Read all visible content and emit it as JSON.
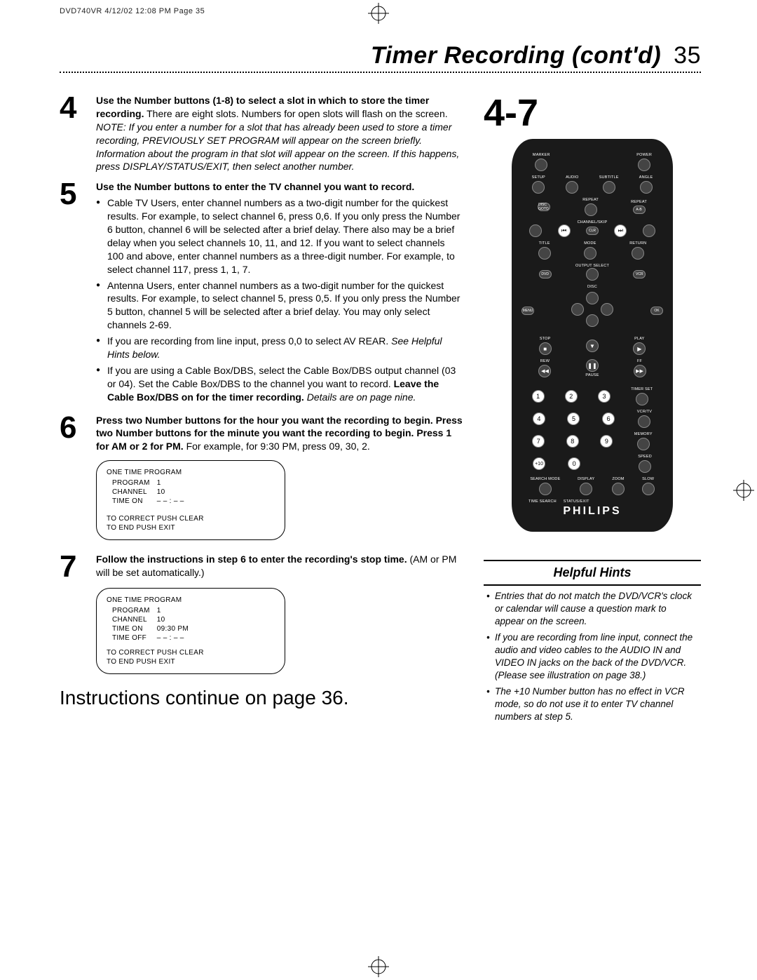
{
  "print_header": "DVD740VR   4/12/02   12:08 PM   Page 35",
  "title": "Timer Recording (cont'd)",
  "page_number": "35",
  "big_steps": "4-7",
  "steps": {
    "s4": {
      "num": "4",
      "bold1": "Use the Number buttons (1-8) to select a slot in which to store the timer recording.",
      "rest": " There are eight slots. Numbers for open slots will flash on the screen.",
      "note": "NOTE: If you enter a number for a slot that has already been used to store a timer recording, PREVIOUSLY SET PROGRAM will appear on the screen briefly. Information about the program in that slot will appear on the screen. If this happens, press DISPLAY/STATUS/EXIT, then select another number."
    },
    "s5": {
      "num": "5",
      "bold1": "Use the Number buttons to enter the TV channel you want to record.",
      "b1": "Cable TV Users, enter channel numbers as a two-digit number for the quickest results. For example, to select channel 6, press 0,6. If you only press the Number 6 button, channel 6 will be selected after a brief delay. There also may be a brief delay when you select channels 10, 11, and 12. If you want to select channels 100 and above, enter channel numbers as a three-digit number. For example, to select channel 117, press 1, 1, 7.",
      "b2": "Antenna Users, enter channel numbers as a two-digit number for the quickest results. For example, to select channel 5, press 0,5. If you only press the Number 5 button, channel 5 will be selected after a brief delay. You may only select channels 2-69.",
      "b3a": "If you are recording from line input, press 0,0 to select AV REAR. ",
      "b3b": "See Helpful Hints below.",
      "b4a": "If you are using a Cable Box/DBS, select the Cable Box/DBS output channel (03 or 04). Set the Cable Box/DBS to the channel you want to record. ",
      "b4bold": "Leave the Cable Box/DBS on for the timer recording.",
      "b4c": " Details are on page nine."
    },
    "s6": {
      "num": "6",
      "bold1": "Press two Number buttons for the hour you want the recording to begin. Press two Number buttons for the minute you want the recording to begin. Press 1 for AM or 2 for PM.",
      "rest": " For example, for 9:30 PM, press 09, 30, 2."
    },
    "s7": {
      "num": "7",
      "bold1": "Follow the instructions in step 6 to enter the recording's stop time.",
      "rest": " (AM or PM will be set automatically.)"
    }
  },
  "screen1": {
    "title": "ONE TIME PROGRAM",
    "rows": [
      [
        "PROGRAM",
        "1"
      ],
      [
        "CHANNEL",
        "10"
      ],
      [
        "TIME ON",
        "– – : – –"
      ]
    ],
    "foot1": "TO CORRECT PUSH CLEAR",
    "foot2": "TO END PUSH EXIT"
  },
  "screen2": {
    "title": "ONE TIME PROGRAM",
    "rows": [
      [
        "PROGRAM",
        "1"
      ],
      [
        "CHANNEL",
        "10"
      ],
      [
        "TIME ON",
        "09:30 PM"
      ],
      [
        "TIME OFF",
        "– – : – –"
      ]
    ],
    "foot1": "TO CORRECT PUSH CLEAR",
    "foot2": "TO END PUSH EXIT"
  },
  "continue_text": "Instructions continue on page 36.",
  "remote": {
    "brand": "PHILIPS",
    "labels": {
      "power": "POWER",
      "marker": "MARKER",
      "setup": "SETUP",
      "audio": "AUDIO",
      "subtitle": "SUBTITLE",
      "angle": "ANGLE",
      "discgoto": "DISC GOTO",
      "repeat": "REPEAT",
      "repeat2": "REPEAT",
      "ab": "A-B",
      "channelskip": "CHANNEL/SKIP",
      "clr": "CLR",
      "title": "TITLE",
      "mode": "MODE",
      "return": "RETURN",
      "output": "OUTPUT SELECT",
      "dvd": "DVD",
      "vcr": "VCR",
      "disc": "DISC",
      "menu": "MENU",
      "ok": "OK",
      "stop": "STOP",
      "play": "PLAY",
      "rew": "REW",
      "ff": "FF",
      "pause": "PAUSE",
      "timerset": "TIMER SET",
      "vcrtv": "VCR/TV",
      "memory": "MEMORY",
      "speed": "SPEED",
      "plus10": "+10",
      "searchmode": "SEARCH MODE",
      "display": "DISPLAY",
      "zoom": "ZOOM",
      "slow": "SLOW",
      "timesearch": "TIME SEARCH",
      "statusexit": "STATUS/EXIT"
    },
    "numbers": [
      "1",
      "2",
      "3",
      "4",
      "5",
      "6",
      "7",
      "8",
      "9",
      "0"
    ]
  },
  "helpful": {
    "title": "Helpful Hints",
    "items": [
      "Entries that do not match the DVD/VCR's clock or calendar will cause a question mark to appear on the screen.",
      "If you are recording from line input, connect the audio and video cables to the AUDIO IN and VIDEO IN jacks on the back of the DVD/VCR. (Please see illustration on page 38.)",
      "The +10 Number button has no effect in VCR mode, so do not use it to enter TV channel numbers at step 5."
    ]
  }
}
